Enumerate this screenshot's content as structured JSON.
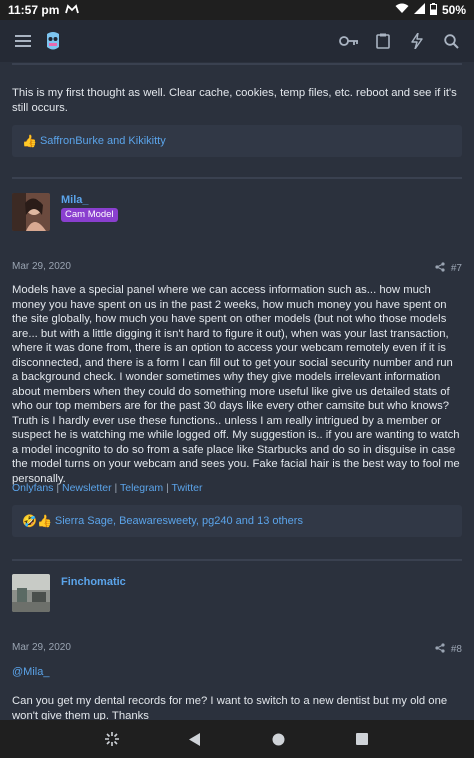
{
  "status_bar": {
    "time": "11:57",
    "time_suffix": "pm",
    "battery": "50%"
  },
  "header": {
    "icons": [
      "menu-icon",
      "app-logo",
      "key-icon",
      "clipboard-icon",
      "bolt-icon",
      "search-icon"
    ]
  },
  "posts": [
    {
      "body": "This is my first thought as well. Clear cache, cookies, temp files, etc. reboot and see if it's still occurs.",
      "reactions": {
        "emoji": "👍",
        "text": "SaffronBurke and Kikikitty"
      }
    },
    {
      "username": "Mila_",
      "badge": "Cam Model",
      "date": "Mar 29, 2020",
      "post_number": "#7",
      "body": "Models have a special panel where we can access information such as... how much money you have spent on us in the past 2 weeks, how much money you have spent on the site globally, how much you have spent on other models (but not who those models are... but with a little digging it isn't hard to figure it out), when was your last transaction, where it was done from, there is an option to access your webcam remotely even if it is disconnected, and there is a form I can fill out to get your social security number and run a background check. I wonder sometimes why they give models irrelevant information about members when they could do something more useful like give us detailed stats of who our top members are for the past 30 days like every other camsite but who knows? Truth is I hardly ever use these functions.. unless I am really intrigued by a member or suspect he is watching me while logged off. My suggestion is.. if you are wanting to watch a model incognito to do so from a safe place like Starbucks and do so in disguise in case the model turns on your webcam and sees you. Fake facial hair is the best way to fool me personally.",
      "signature_links": [
        "Onlyfans",
        "Newsletter",
        "Telegram",
        "Twitter"
      ],
      "signature_separator": " | ",
      "reactions": {
        "emoji": "🤣👍",
        "text": "Sierra Sage, Beawaresweety, pg240 and 13 others"
      }
    },
    {
      "username": "Finchomatic",
      "date": "Mar 29, 2020",
      "post_number": "#8",
      "mention": "@Mila_",
      "body": "Can you get my dental records for me? I want to switch to a new dentist but my old one won't give them up. Thanks"
    }
  ],
  "nav_bar": {
    "icons": [
      "pinwheel-icon",
      "back-icon",
      "home-icon",
      "recents-icon"
    ]
  },
  "colors": {
    "background": "#2b313d",
    "link": "#5ba4ea",
    "badge": "#8a3fcf"
  }
}
